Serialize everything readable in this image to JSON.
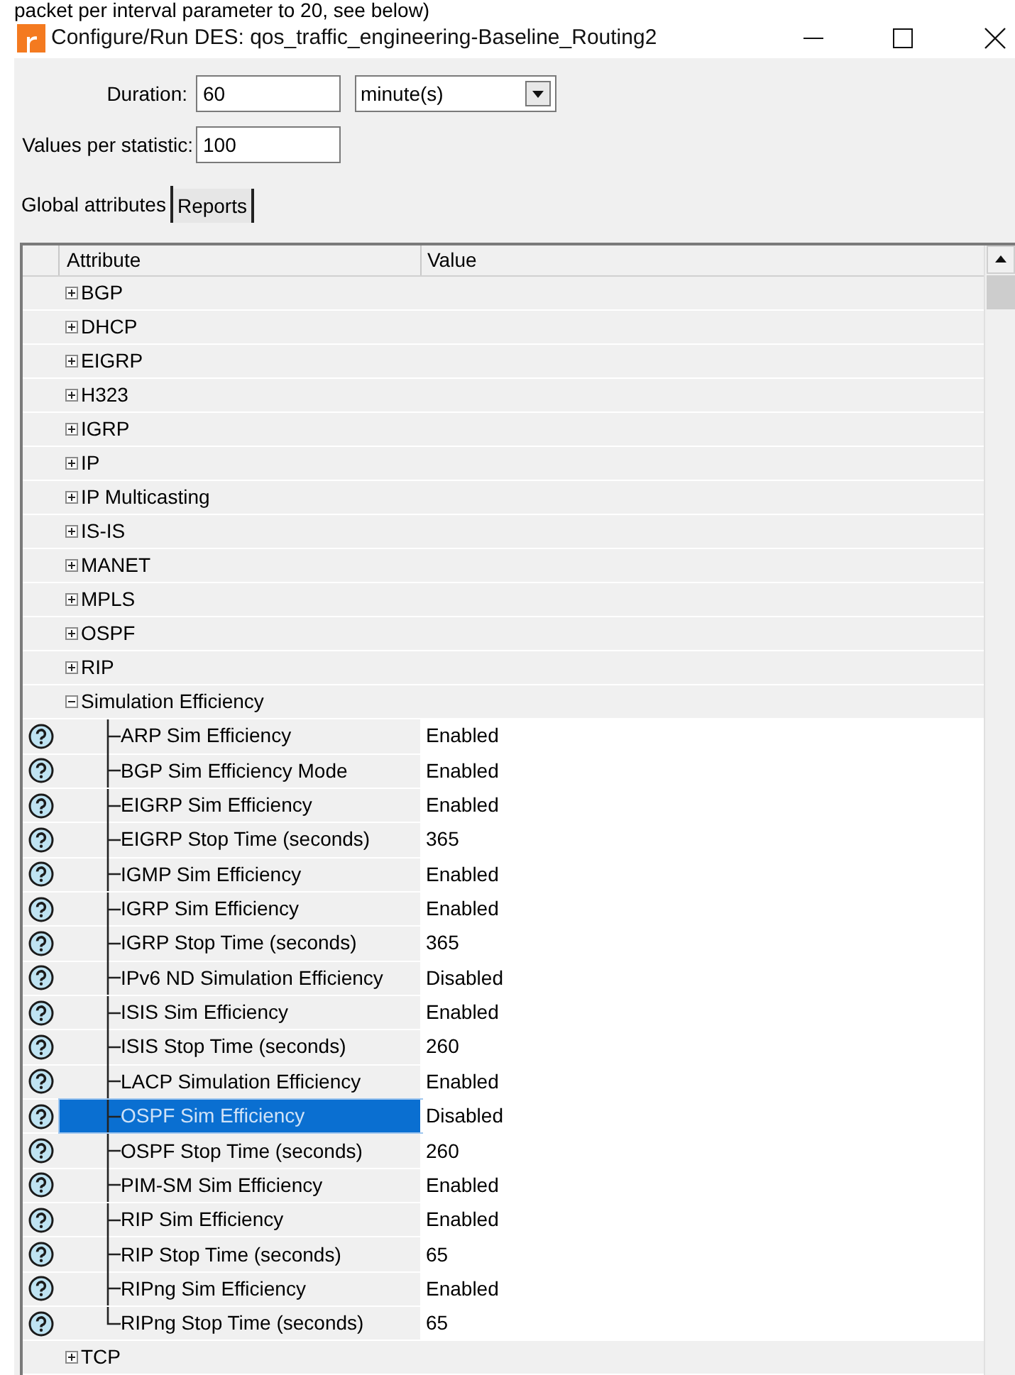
{
  "caption_fragment": "packet per interval parameter to 20, see below)",
  "window": {
    "title": "Configure/Run DES: qos_traffic_engineering-Baseline_Routing2"
  },
  "duration": {
    "label": "Duration:",
    "value": "60"
  },
  "unit_select": {
    "value": "minute(s)"
  },
  "values_per_statistic": {
    "label": "Values per statistic:",
    "value": "100"
  },
  "tabs": [
    {
      "label": "Global attributes",
      "selected": true
    },
    {
      "label": "Reports",
      "selected": false
    }
  ],
  "table": {
    "columns": [
      "Attribute",
      "Value"
    ],
    "rows": [
      {
        "attribute": "BGP",
        "expanded": false
      },
      {
        "attribute": "DHCP",
        "expanded": false
      },
      {
        "attribute": "EIGRP",
        "expanded": false
      },
      {
        "attribute": "H323",
        "expanded": false
      },
      {
        "attribute": "IGRP",
        "expanded": false
      },
      {
        "attribute": "IP",
        "expanded": false
      },
      {
        "attribute": "IP Multicasting",
        "expanded": false
      },
      {
        "attribute": "IS-IS",
        "expanded": false
      },
      {
        "attribute": "MANET",
        "expanded": false
      },
      {
        "attribute": "MPLS",
        "expanded": false
      },
      {
        "attribute": "OSPF",
        "expanded": false
      },
      {
        "attribute": "RIP",
        "expanded": false
      },
      {
        "attribute": "Simulation Efficiency",
        "expanded": true,
        "children": [
          {
            "attribute": "ARP Sim Efficiency",
            "value": "Enabled",
            "selected": false
          },
          {
            "attribute": "BGP Sim Efficiency Mode",
            "value": "Enabled",
            "selected": false
          },
          {
            "attribute": "EIGRP Sim Efficiency",
            "value": "Enabled",
            "selected": false
          },
          {
            "attribute": "EIGRP Stop Time (seconds)",
            "value": "365",
            "selected": false
          },
          {
            "attribute": "IGMP Sim Efficiency",
            "value": "Enabled",
            "selected": false
          },
          {
            "attribute": "IGRP Sim Efficiency",
            "value": "Enabled",
            "selected": false
          },
          {
            "attribute": "IGRP Stop Time (seconds)",
            "value": "365",
            "selected": false
          },
          {
            "attribute": "IPv6 ND Simulation Efficiency",
            "value": "Disabled",
            "selected": false
          },
          {
            "attribute": "ISIS Sim Efficiency",
            "value": "Enabled",
            "selected": false
          },
          {
            "attribute": "ISIS Stop Time (seconds)",
            "value": "260",
            "selected": false
          },
          {
            "attribute": "LACP Simulation Efficiency",
            "value": "Enabled",
            "selected": false
          },
          {
            "attribute": "OSPF Sim Efficiency",
            "value": "Disabled",
            "selected": true
          },
          {
            "attribute": "OSPF Stop Time (seconds)",
            "value": "260",
            "selected": false
          },
          {
            "attribute": "PIM-SM Sim Efficiency",
            "value": "Enabled",
            "selected": false
          },
          {
            "attribute": "RIP Sim Efficiency",
            "value": "Enabled",
            "selected": false
          },
          {
            "attribute": "RIP Stop Time (seconds)",
            "value": "65",
            "selected": false
          },
          {
            "attribute": "RIPng Sim Efficiency",
            "value": "Enabled",
            "selected": false
          },
          {
            "attribute": "RIPng Stop Time (seconds)",
            "value": "65",
            "selected": false
          }
        ]
      },
      {
        "attribute": "TCP",
        "expanded": false
      }
    ]
  }
}
